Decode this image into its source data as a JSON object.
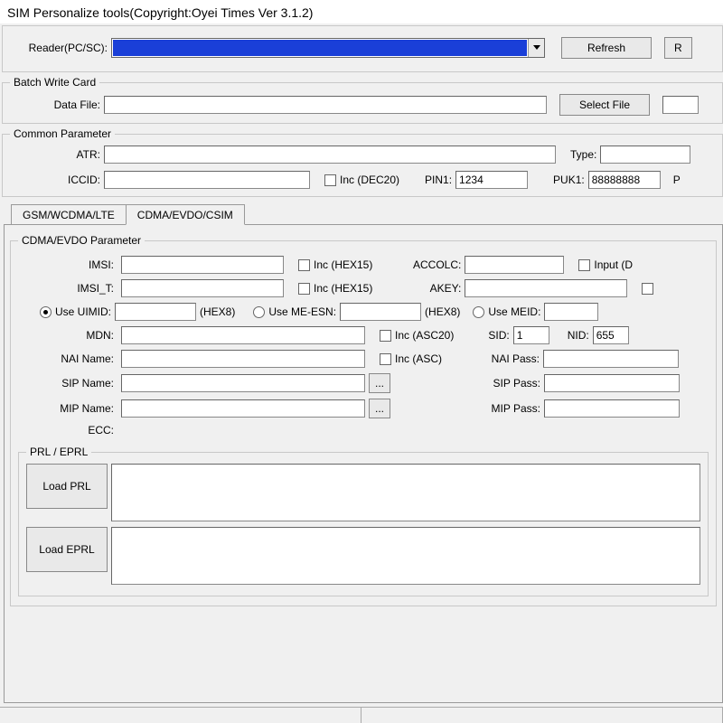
{
  "window": {
    "title": "SIM Personalize tools(Copyright:Oyei Times Ver 3.1.2)"
  },
  "topbar": {
    "reader_label": "Reader(PC/SC):",
    "refresh": "Refresh",
    "partial_r": "R"
  },
  "batch": {
    "legend": "Batch Write Card",
    "datafile_label": "Data File:",
    "datafile": "",
    "select_file": "Select File"
  },
  "common": {
    "legend": "Common Parameter",
    "atr_label": "ATR:",
    "atr": "",
    "type_label": "Type:",
    "type": "",
    "iccid_label": "ICCID:",
    "iccid": "",
    "iccid_inc": "Inc  (DEC20)",
    "pin1_label": "PIN1:",
    "pin1": "1234",
    "puk1_label": "PUK1:",
    "puk1": "88888888",
    "trailing_p": "P"
  },
  "tabs": {
    "gsm": "GSM/WCDMA/LTE",
    "cdma": "CDMA/EVDO/CSIM"
  },
  "cdma": {
    "legend": "CDMA/EVDO Parameter",
    "imsi_label": "IMSI:",
    "imsi": "",
    "imsi_inc": "Inc  (HEX15)",
    "accolc_label": "ACCOLC:",
    "accolc": "",
    "accolc_input": "Input  (D",
    "imsit_label": "IMSI_T:",
    "imsit": "",
    "imsit_inc": "Inc  (HEX15)",
    "akey_label": "AKEY:",
    "akey": "",
    "use_uimid": "Use UIMID:",
    "uimid": "",
    "uimid_hint": "(HEX8)",
    "use_meesn": "Use ME-ESN:",
    "meesn": "",
    "meesn_hint": "(HEX8)",
    "use_meid": "Use MEID:",
    "mdn_label": "MDN:",
    "mdn": "",
    "mdn_inc": "Inc  (ASC20)",
    "sid_label": "SID:",
    "sid": "1",
    "nid_label": "NID:",
    "nid": "655",
    "nainame_label": "NAI Name:",
    "nainame": "",
    "nainame_inc": "Inc  (ASC)",
    "naipass_label": "NAI Pass:",
    "naipass": "",
    "sipname_label": "SIP Name:",
    "sipname": "",
    "sippass_label": "SIP Pass:",
    "sippass": "",
    "mipname_label": "MIP Name:",
    "mipname": "",
    "mippass_label": "MIP Pass:",
    "mippass": "",
    "ecc_label": "ECC:",
    "browse": "..."
  },
  "prl": {
    "legend": "PRL / EPRL",
    "load_prl": "Load PRL",
    "load_eprl": "Load EPRL",
    "prl_text": "",
    "eprl_text": ""
  }
}
